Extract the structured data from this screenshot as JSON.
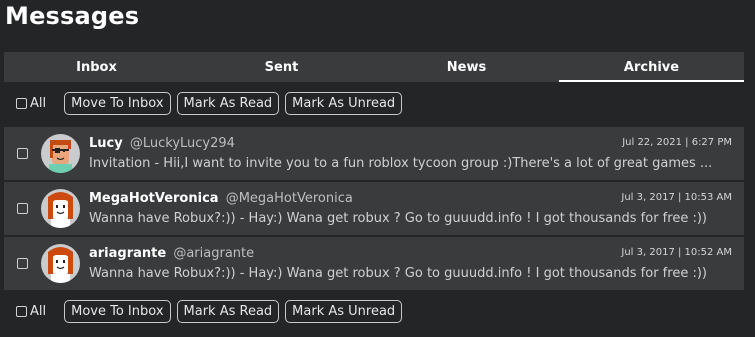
{
  "page": {
    "title": "Messages"
  },
  "tabs": [
    {
      "label": "Inbox",
      "active": false
    },
    {
      "label": "Sent",
      "active": false
    },
    {
      "label": "News",
      "active": false
    },
    {
      "label": "Archive",
      "active": true
    }
  ],
  "toolbar": {
    "all_label": "All",
    "move_to_inbox": "Move To Inbox",
    "mark_as_read": "Mark As Read",
    "mark_as_unread": "Mark As Unread"
  },
  "messages": [
    {
      "name": "Lucy",
      "handle": "@LuckyLucy294",
      "timestamp": "Jul 22, 2021 | 6:27 PM",
      "preview": "Invitation  - Hii,I want to invite you to a fun roblox tycoon group :)There's a lot of great games ...",
      "avatar": {
        "icon": "avatar-eyepatch-redhair-icon",
        "bg": "#c9cbcc",
        "hair": "#c44a12",
        "skin": "#e8a67c",
        "shirt": "#6bcfb0"
      }
    },
    {
      "name": "MegaHotVeronica",
      "handle": "@MegaHotVeronica",
      "timestamp": "Jul 3, 2017 | 10:53 AM",
      "preview": "Wanna have Robux?:))  - Hay:) Wana get robux ? Go to guuudd.info ! I got thousands for free :))",
      "avatar": {
        "icon": "avatar-redhair-icon",
        "bg": "#c9cbcc",
        "hair": "#cc4a10",
        "skin": "#ffffff",
        "shirt": "#ffffff"
      }
    },
    {
      "name": "ariagrante",
      "handle": "@ariagrante",
      "timestamp": "Jul 3, 2017 | 10:52 AM",
      "preview": "Wanna have Robux?:))  - Hay:) Wana get robux ? Go to guuudd.info ! I got thousands for free :))",
      "avatar": {
        "icon": "avatar-redhair-icon",
        "bg": "#c9cbcc",
        "hair": "#cc4a10",
        "skin": "#ffffff",
        "shirt": "#ffffff"
      }
    }
  ],
  "colors": {
    "background": "#232527",
    "panel": "#393b3d",
    "text": "#ffffff",
    "muted_text": "#bdbebe"
  }
}
